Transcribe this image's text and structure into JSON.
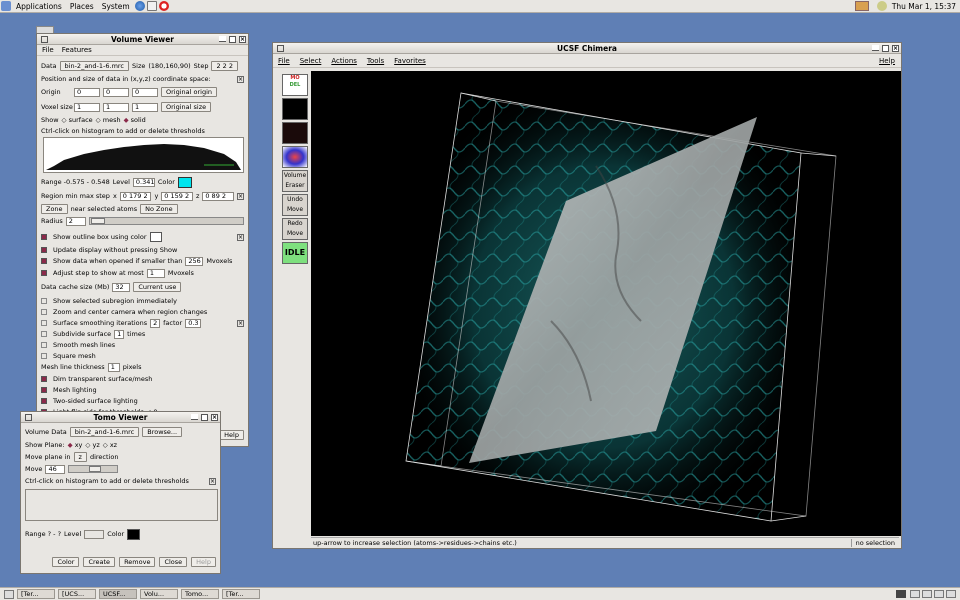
{
  "top_panel": {
    "menus": [
      "Applications",
      "Places",
      "System"
    ],
    "clock": "Thu Mar  1, 15:37"
  },
  "volume_viewer": {
    "title": "Volume Viewer",
    "menu": [
      "File",
      "Features"
    ],
    "data_label": "Data",
    "data_value": "bin-2_and-1-6.mrc",
    "size_label": "Size",
    "size_value": "(180,160,90)",
    "step_label": "Step",
    "step_value": "2 2 2",
    "section_title": "Position and size of data in (x,y,z) coordinate space:",
    "origin_label": "Origin",
    "origin": [
      "0",
      "0",
      "0"
    ],
    "origin_btn": "Original origin",
    "voxel_label": "Voxel size",
    "voxel": [
      "1",
      "1",
      "1"
    ],
    "voxel_btn": "Original size",
    "show_label": "Show",
    "show_opts": [
      "surface",
      "mesh",
      "solid"
    ],
    "hist_hint": "Ctrl-click on histogram to add or delete thresholds",
    "range_text": "Range   -0.575 - 0.548",
    "level_label": "Level",
    "level_value": "0.341",
    "color_label": "Color",
    "color_swatch": "#00e5ee",
    "region_label": "Region min max step",
    "rx_label": "x",
    "rx": "0 179 2",
    "ry_label": "y",
    "ry": "0 159 2",
    "rz_label": "z",
    "rz": "0 89 2",
    "zone_btn": "Zone",
    "zone_text": "near selected atoms",
    "nozone_btn": "No Zone",
    "radius_label": "Radius",
    "radius_value": "2",
    "options": [
      {
        "label": "Show outline box using color",
        "checked": true
      },
      {
        "label": "Update display without pressing Show",
        "checked": true
      },
      {
        "label": "Show data when opened if smaller than",
        "checked": true,
        "val": "256",
        "unit": "Mvoxels"
      },
      {
        "label": "Adjust step to show at most",
        "checked": true,
        "val": "1",
        "unit": "Mvoxels"
      }
    ],
    "cache_label": "Data cache size (Mb)",
    "cache_value": "32",
    "cache_btn": "Current use",
    "options2": [
      {
        "label": "Show selected subregion immediately",
        "checked": false
      },
      {
        "label": "Zoom and center camera when region changes",
        "checked": false
      },
      {
        "label": "Surface smoothing iterations",
        "checked": false,
        "val": "2",
        "extra": "factor",
        "val2": "0.3"
      },
      {
        "label": "Subdivide surface",
        "checked": false,
        "val": "1",
        "unit": "times"
      },
      {
        "label": "Smooth mesh lines",
        "checked": false
      },
      {
        "label": "Square mesh",
        "checked": false
      }
    ],
    "mesh_thick_label": "Mesh line thickness",
    "mesh_thick": "1",
    "mesh_unit": "pixels",
    "options3": [
      {
        "label": "Dim transparent surface/mesh",
        "checked": true
      },
      {
        "label": "Mesh lighting",
        "checked": true
      },
      {
        "label": "Two-sided surface lighting",
        "checked": true
      },
      {
        "label": "Light flip side for thresholds < 0",
        "checked": true
      }
    ],
    "help_btn": "Help"
  },
  "tomo_viewer": {
    "title": "Tomo Viewer",
    "vol_label": "Volume Data",
    "vol_value": "bin-2_and-1-6.mrc",
    "browse_btn": "Browse...",
    "plane_label": "Show Plane:",
    "planes": [
      "xy",
      "yz",
      "xz"
    ],
    "move_label": "Move plane in",
    "move_dir": "z",
    "direction_text": "direction",
    "move2_label": "Move",
    "move_value": "46",
    "hist_hint": "Ctrl-click on histogram to add or delete thresholds",
    "range_text": "Range   ? - ?",
    "level_label": "Level",
    "color_label": "Color",
    "color_swatch": "#000000",
    "buttons": [
      "Color",
      "Create",
      "Remove",
      "Close",
      "Help"
    ]
  },
  "chimera": {
    "title": "UCSF Chimera",
    "menu": [
      "File",
      "Select",
      "Actions",
      "Tools",
      "Favorites"
    ],
    "help": "Help",
    "side_tools": [
      "Volume Eraser",
      "Undo Move",
      "Redo Move"
    ],
    "idle": "IDLE",
    "status": "up-arrow to increase selection (atoms->residues->chains etc.)",
    "selection": "no selection"
  },
  "taskbar": {
    "tasks": [
      "[Ter...",
      "[UCS...",
      "UCSF...",
      "Volu...",
      "Tomo...",
      "[Ter..."
    ]
  }
}
